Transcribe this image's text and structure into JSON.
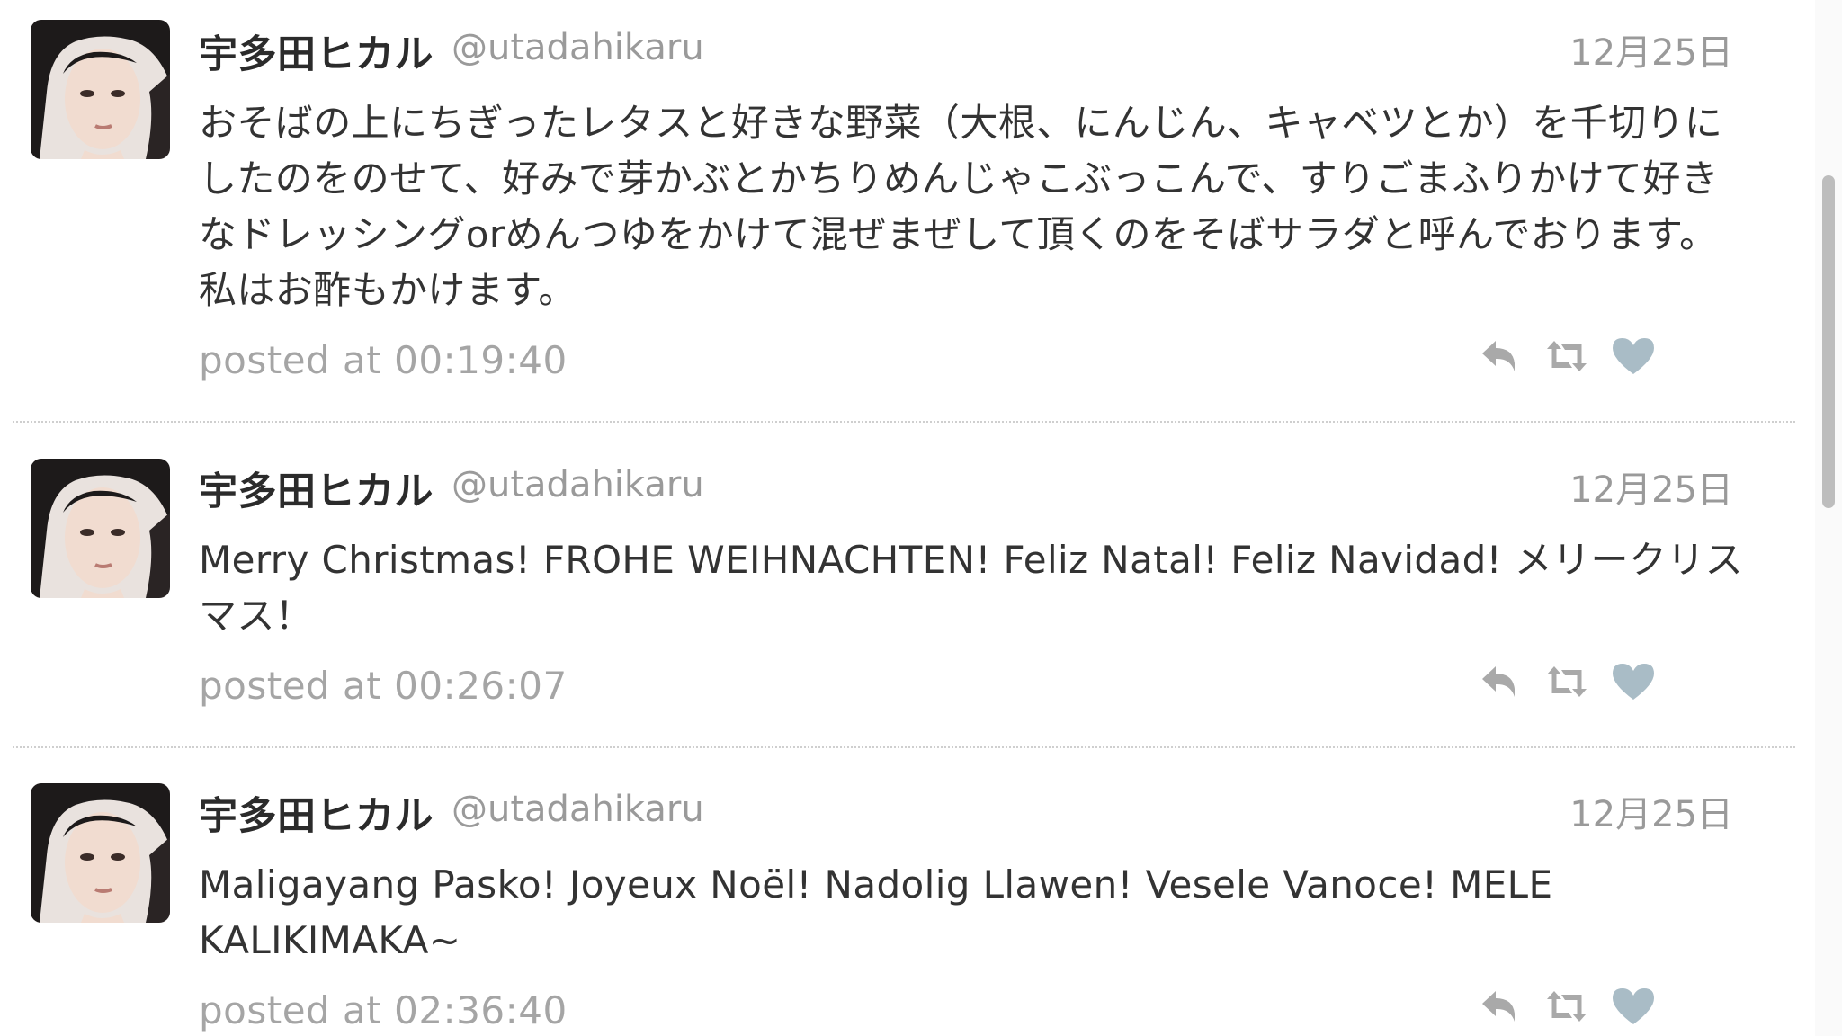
{
  "colors": {
    "name": "#2b2b2b",
    "muted": "#9a9a9a",
    "text": "#333333",
    "action_icon": "#a9a9a9",
    "heart": "#a9bcc6",
    "divider": "#cfcfcf"
  },
  "icons": {
    "reply": "reply-icon",
    "retweet": "retweet-icon",
    "favorite": "heart-icon"
  },
  "tweets": [
    {
      "name": "宇多田ヒカル",
      "handle": "@utadahikaru",
      "date": "12月25日",
      "text": "おそばの上にちぎったレタスと好きな野菜（大根、にんじん、キャベツとか）を千切りにしたのをのせて、好みで芽かぶとかちりめんじゃこぶっこんで、すりごまふりかけて好きなドレッシングorめんつゆをかけて混ぜまぜして頂くのをそばサラダと呼んでおります。私はお酢もかけます。",
      "posted": "posted at 00:19:40"
    },
    {
      "name": "宇多田ヒカル",
      "handle": "@utadahikaru",
      "date": "12月25日",
      "text": "Merry Christmas! FROHE WEIHNACHTEN! Feliz Natal! Feliz Navidad! メリークリスマス！",
      "posted": "posted at 00:26:07"
    },
    {
      "name": "宇多田ヒカル",
      "handle": "@utadahikaru",
      "date": "12月25日",
      "text": "Maligayang Pasko! Joyeux Noël! Nadolig Llawen! Vesele Vanoce! MELE KALIKIMAKA~",
      "posted": "posted at 02:36:40"
    }
  ]
}
